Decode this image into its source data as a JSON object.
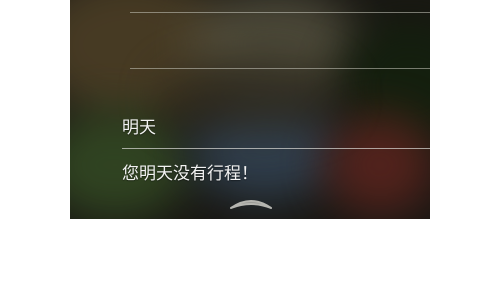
{
  "conversation": {
    "user_query": "明天",
    "assistant_reply": "您明天没有行程！"
  },
  "icons": {
    "pull_handle": "grabber-handle-icon"
  },
  "colors": {
    "text": "#f2f2f2",
    "divider": "#c8c8be"
  }
}
